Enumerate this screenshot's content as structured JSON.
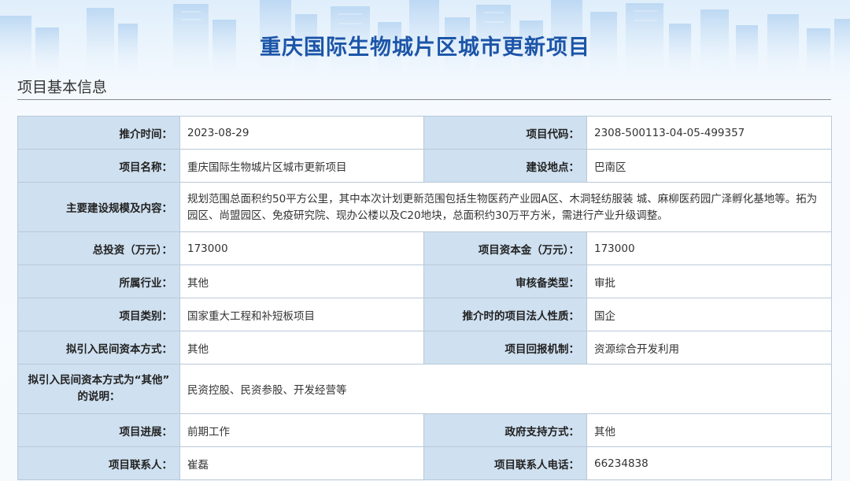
{
  "page": {
    "title": "重庆国际生物城片区城市更新项目"
  },
  "section": {
    "title": "项目基本信息"
  },
  "info": {
    "recommend_time": {
      "label": "推介时间：",
      "value": "2023-08-29"
    },
    "project_code": {
      "label": "项目代码：",
      "value": "2308-500113-04-05-499357"
    },
    "project_name": {
      "label": "项目名称：",
      "value": "重庆国际生物城片区城市更新项目"
    },
    "location": {
      "label": "建设地点：",
      "value": "巴南区"
    },
    "scale_content": {
      "label": "主要建设规模及内容：",
      "value": "规划范围总面积约50平方公里，其中本次计划更新范围包括生物医药产业园A区、木洞轻纺服装 城、麻柳医药园广泽孵化基地等。拓为园区、尚盟园区、免疫研究院、现办公楼以及C20地块，总面积约30万平方米，需进行产业升级调整。"
    },
    "total_investment": {
      "label": "总投资（万元）：",
      "value": "173000"
    },
    "capital": {
      "label": "项目资本金（万元）：",
      "value": "173000"
    },
    "industry": {
      "label": "所属行业：",
      "value": "其他"
    },
    "approval_type": {
      "label": "审核备类型：",
      "value": "审批"
    },
    "category": {
      "label": "项目类别：",
      "value": "国家重大工程和补短板项目"
    },
    "legal_nature": {
      "label": "推介时的项目法人性质：",
      "value": "国企"
    },
    "private_capital_method": {
      "label": "拟引入民间资本方式：",
      "value": "其他"
    },
    "return_mechanism": {
      "label": "项目回报机制：",
      "value": "资源综合开发利用"
    },
    "other_explanation": {
      "label_line1": "拟引入民间资本方式为“其他”",
      "label_line2": "的说明：",
      "value": "民资控股、民资参股、开发经营等"
    },
    "progress": {
      "label": "项目进展：",
      "value": "前期工作"
    },
    "gov_support": {
      "label": "政府支持方式：",
      "value": "其他"
    },
    "contact": {
      "label": "项目联系人：",
      "value": "崔磊"
    },
    "contact_phone": {
      "label": "项目联系人电话：",
      "value": "66234838"
    }
  },
  "colors": {
    "title": "#1c55a8",
    "label_bg": "#cfe0f0",
    "border": "#b9c9d8"
  }
}
